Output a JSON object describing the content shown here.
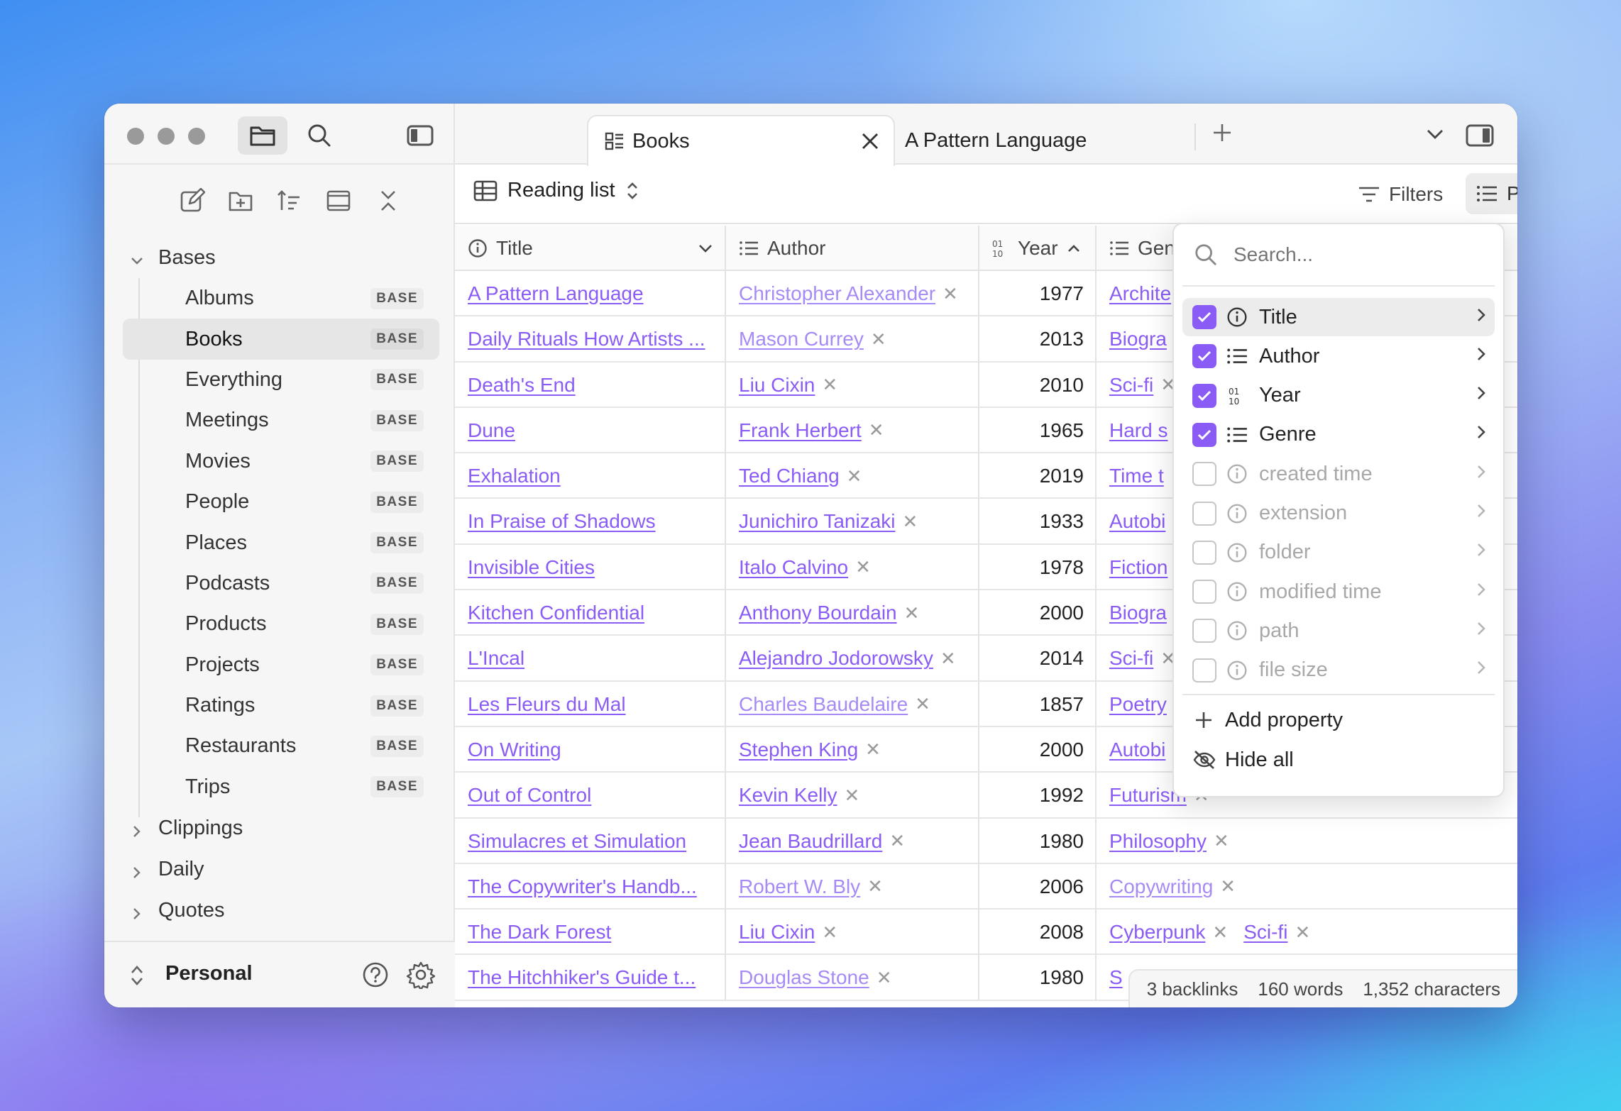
{
  "sidebar": {
    "sections": [
      {
        "label": "Bases",
        "expanded": true
      },
      {
        "label": "Clippings",
        "expanded": false
      },
      {
        "label": "Daily",
        "expanded": false
      },
      {
        "label": "Quotes",
        "expanded": false
      }
    ],
    "bases": [
      {
        "label": "Albums",
        "badge": "BASE"
      },
      {
        "label": "Books",
        "badge": "BASE",
        "selected": true
      },
      {
        "label": "Everything",
        "badge": "BASE"
      },
      {
        "label": "Meetings",
        "badge": "BASE"
      },
      {
        "label": "Movies",
        "badge": "BASE"
      },
      {
        "label": "People",
        "badge": "BASE"
      },
      {
        "label": "Places",
        "badge": "BASE"
      },
      {
        "label": "Podcasts",
        "badge": "BASE"
      },
      {
        "label": "Products",
        "badge": "BASE"
      },
      {
        "label": "Projects",
        "badge": "BASE"
      },
      {
        "label": "Ratings",
        "badge": "BASE"
      },
      {
        "label": "Restaurants",
        "badge": "BASE"
      },
      {
        "label": "Trips",
        "badge": "BASE"
      }
    ],
    "vault_name": "Personal"
  },
  "tabs": [
    {
      "label": "Books",
      "active": true
    },
    {
      "label": "A Pattern Language",
      "active": false
    }
  ],
  "view": {
    "name": "Reading list",
    "filters_label": "Filters",
    "properties_label": "Properties"
  },
  "columns": {
    "title": "Title",
    "author": "Author",
    "year": "Year",
    "genre": "Gen"
  },
  "rows": [
    {
      "title": "A Pattern Language",
      "author": "Christopher Alexander",
      "author_faded": true,
      "year": "1977",
      "genre": [
        "Archite"
      ]
    },
    {
      "title": "Daily Rituals How Artists ...",
      "author": "Mason Currey",
      "author_faded": true,
      "year": "2013",
      "genre": [
        "Biogra"
      ]
    },
    {
      "title": "Death's End",
      "author": "Liu Cixin",
      "author_faded": false,
      "year": "2010",
      "genre": [
        "Sci-fi"
      ]
    },
    {
      "title": "Dune",
      "author": "Frank Herbert",
      "author_faded": false,
      "year": "1965",
      "genre": [
        "Hard s"
      ]
    },
    {
      "title": "Exhalation",
      "author": "Ted Chiang",
      "author_faded": false,
      "year": "2019",
      "genre": [
        "Time t"
      ]
    },
    {
      "title": "In Praise of Shadows",
      "author": "Junichiro Tanizaki",
      "author_faded": false,
      "year": "1933",
      "genre": [
        "Autobi"
      ]
    },
    {
      "title": "Invisible Cities",
      "author": "Italo Calvino",
      "author_faded": false,
      "year": "1978",
      "genre": [
        "Fiction"
      ]
    },
    {
      "title": "Kitchen Confidential",
      "author": "Anthony Bourdain",
      "author_faded": false,
      "year": "2000",
      "genre": [
        "Biogra"
      ]
    },
    {
      "title": "L'Incal",
      "author": "Alejandro Jodorowsky",
      "author_faded": false,
      "year": "2014",
      "genre": [
        "Sci-fi"
      ]
    },
    {
      "title": "Les Fleurs du Mal",
      "author": "Charles Baudelaire",
      "author_faded": true,
      "year": "1857",
      "genre": [
        "Poetry"
      ]
    },
    {
      "title": "On Writing",
      "author": "Stephen King",
      "author_faded": false,
      "year": "2000",
      "genre": [
        "Autobi"
      ]
    },
    {
      "title": "Out of Control",
      "author": "Kevin Kelly",
      "author_faded": false,
      "year": "1992",
      "genre": [
        "Futurism"
      ]
    },
    {
      "title": "Simulacres et Simulation",
      "author": "Jean Baudrillard",
      "author_faded": false,
      "year": "1980",
      "genre": [
        "Philosophy"
      ]
    },
    {
      "title": "The Copywriter's Handb...",
      "author": "Robert W. Bly",
      "author_faded": true,
      "year": "2006",
      "genre": [
        "Copywriting"
      ],
      "genre_faded": true
    },
    {
      "title": "The Dark Forest",
      "author": "Liu Cixin",
      "author_faded": false,
      "year": "2008",
      "genre": [
        "Cyberpunk",
        "Sci-fi"
      ]
    },
    {
      "title": "The Hitchhiker's Guide t...",
      "author": "Douglas Stone",
      "author_faded": true,
      "year": "1980",
      "genre": [
        "S"
      ]
    }
  ],
  "properties_menu": {
    "search_placeholder": "Search...",
    "items": [
      {
        "label": "Title",
        "checked": true,
        "icon": "info-icon"
      },
      {
        "label": "Author",
        "checked": true,
        "icon": "list-icon"
      },
      {
        "label": "Year",
        "checked": true,
        "icon": "number-icon"
      },
      {
        "label": "Genre",
        "checked": true,
        "icon": "list-icon"
      },
      {
        "label": "created time",
        "checked": false,
        "icon": "info-icon"
      },
      {
        "label": "extension",
        "checked": false,
        "icon": "info-icon"
      },
      {
        "label": "folder",
        "checked": false,
        "icon": "info-icon"
      },
      {
        "label": "modified time",
        "checked": false,
        "icon": "info-icon"
      },
      {
        "label": "path",
        "checked": false,
        "icon": "info-icon"
      },
      {
        "label": "file size",
        "checked": false,
        "icon": "info-icon"
      }
    ],
    "add_property_label": "Add property",
    "hide_all_label": "Hide all"
  },
  "status_bar": {
    "backlinks": "3 backlinks",
    "words": "160 words",
    "characters": "1,352 characters"
  },
  "colors": {
    "accent": "#8a5cf5",
    "accent_faded": "#a68af5"
  }
}
